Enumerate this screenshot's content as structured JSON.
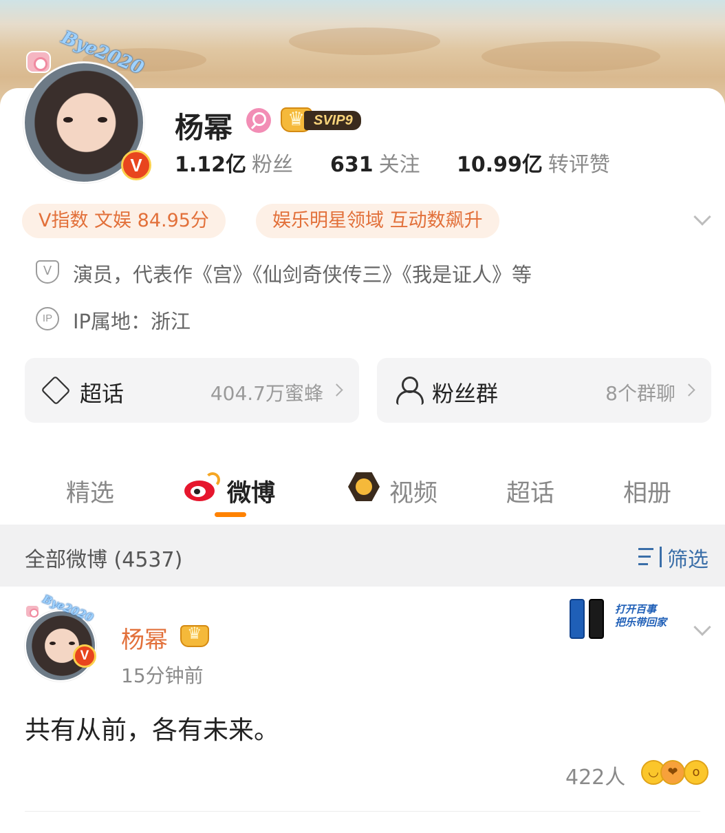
{
  "profile": {
    "avatar_caption": "Bye2020",
    "name": "杨幂",
    "verified_badge": "V",
    "member_level": "SVIP9",
    "stats": [
      {
        "value": "1.12亿",
        "label": "粉丝"
      },
      {
        "value": "631",
        "label": "关注"
      },
      {
        "value": "10.99亿",
        "label": "转评赞"
      }
    ],
    "chips": [
      "V指数 文娱 84.95分",
      "娱乐明星领域 互动数飙升"
    ],
    "bio": "演员，代表作《宫》《仙剑奇侠传三》《我是证人》等",
    "ip_location": "IP属地：浙江",
    "shield_glyph": "V",
    "ip_glyph": "IP"
  },
  "entries": {
    "super_topic": {
      "title": "超话",
      "value": "404.7万蜜蜂"
    },
    "fan_group": {
      "title": "粉丝群",
      "value": "8个群聊"
    }
  },
  "tabs": [
    "精选",
    "微博",
    "视频",
    "超话",
    "相册"
  ],
  "filter_bar": {
    "all_posts": "全部微博 (4537)",
    "filter_label": "筛选"
  },
  "post": {
    "author": "杨幂",
    "time": "15分钟前",
    "text": "共有从前，各有未来。",
    "reaction_count": "422人",
    "ad_slogan_line1": "打开百事",
    "ad_slogan_line2": "把乐带回家"
  },
  "colors": {
    "accent_orange": "#ff8200",
    "name_orange": "#e2703a",
    "chip_bg": "#fdf0e6",
    "link_blue": "#3a6ea8",
    "weibo_red": "#e6162d"
  }
}
